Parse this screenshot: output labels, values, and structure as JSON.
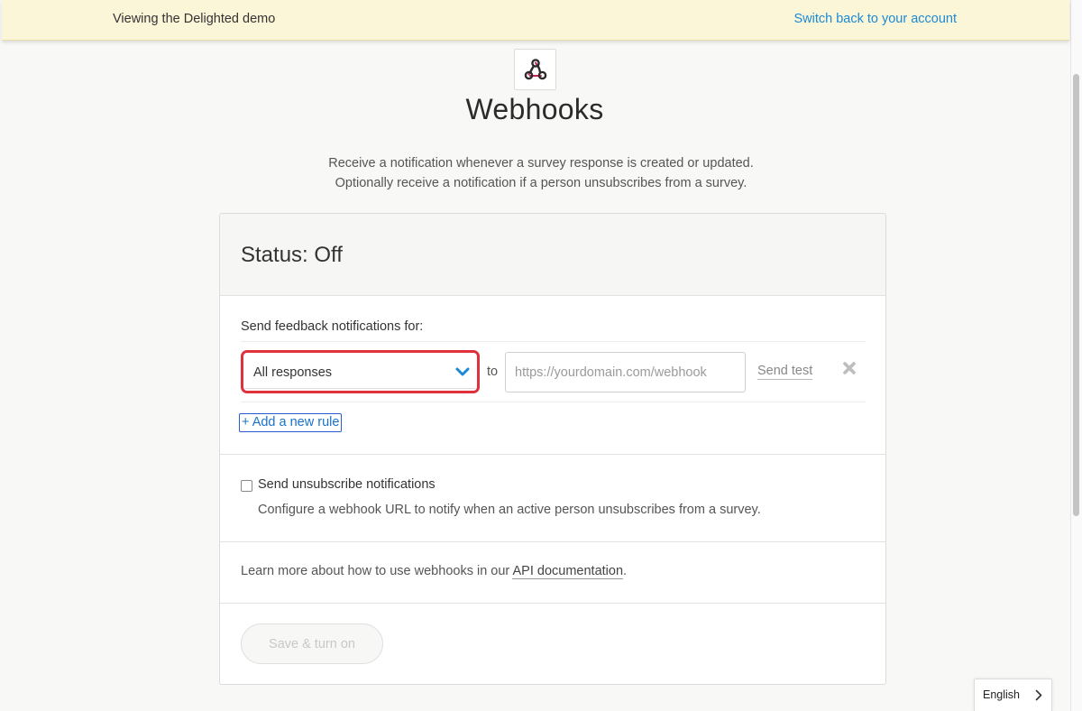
{
  "banner": {
    "text": "Viewing the Delighted demo",
    "link": "Switch back to your account"
  },
  "page": {
    "title": "Webhooks",
    "description_line1": "Receive a notification whenever a survey response is created or updated.",
    "description_line2": "Optionally receive a notification if a person unsubscribes from a survey."
  },
  "status": {
    "title": "Status: Off"
  },
  "feedback": {
    "label": "Send feedback notifications for:",
    "rule": {
      "select_value": "All responses",
      "to_label": "to",
      "url_placeholder": "https://yourdomain.com/webhook",
      "url_value": "",
      "send_test": "Send test"
    },
    "add_rule": "+ Add a new rule"
  },
  "unsubscribe": {
    "label": "Send unsubscribe notifications",
    "checked": false,
    "description": "Configure a webhook URL to notify when an active person unsubscribes from a survey."
  },
  "learn_more": {
    "prefix": "Learn more about how to use webhooks in our ",
    "link": "API documentation",
    "suffix": "."
  },
  "save_button": "Save & turn on",
  "language": "English",
  "colors": {
    "accent_blue": "#1a8ad6",
    "highlight_red": "#e0313e",
    "banner_bg": "#fcf6d8",
    "webhook_icon_pink": "#c7214f"
  },
  "icons": [
    "webhooks-logo-icon",
    "chevron-down-icon",
    "close-icon",
    "checkbox-icon",
    "chevron-right-icon"
  ]
}
